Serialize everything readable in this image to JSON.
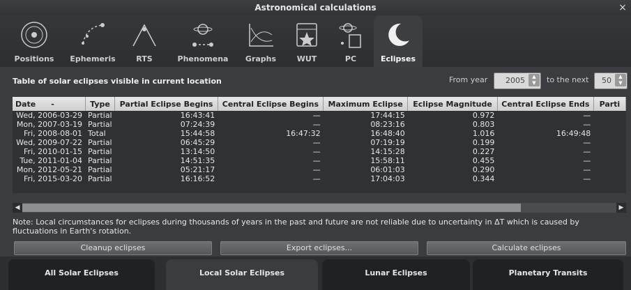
{
  "window": {
    "title": "Astronomical calculations",
    "close_glyph": "×"
  },
  "toolbar": {
    "tabs": [
      {
        "label": "Positions",
        "icon": "positions-icon"
      },
      {
        "label": "Ephemeris",
        "icon": "ephemeris-icon"
      },
      {
        "label": "RTS",
        "icon": "rts-icon"
      },
      {
        "label": "Phenomena",
        "icon": "phenomena-icon"
      },
      {
        "label": "Graphs",
        "icon": "graphs-icon"
      },
      {
        "label": "WUT",
        "icon": "wut-icon"
      },
      {
        "label": "PC",
        "icon": "pc-icon"
      },
      {
        "label": "Eclipses",
        "icon": "eclipses-icon"
      }
    ]
  },
  "main": {
    "heading": "Table of solar eclipses visible in current location",
    "from_year_label": "From year",
    "from_year_value": "2005",
    "to_next_label": "to the next",
    "to_next_value": "50"
  },
  "table": {
    "columns": [
      "Date",
      "Type",
      "Partial Eclipse Begins",
      "Central Eclipse Begins",
      "Maximum Eclipse",
      "Eclipse Magnitude",
      "Central Eclipse Ends",
      "Parti"
    ],
    "sort_marker": "-",
    "rows": [
      [
        "Wed, 2006-03-29",
        "Partial",
        "16:43:41",
        "—",
        "17:44:15",
        "0.972",
        "—",
        ""
      ],
      [
        "Mon, 2007-03-19",
        "Partial",
        "07:24:39",
        "—",
        "08:23:16",
        "0.803",
        "—",
        ""
      ],
      [
        "Fri, 2008-08-01",
        "Total",
        "15:44:58",
        "16:47:32",
        "16:48:40",
        "1.016",
        "16:49:48",
        ""
      ],
      [
        "Wed, 2009-07-22",
        "Partial",
        "06:45:29",
        "—",
        "07:19:19",
        "0.199",
        "—",
        ""
      ],
      [
        "Fri, 2010-01-15",
        "Partial",
        "13:14:50",
        "—",
        "14:15:28",
        "0.227",
        "—",
        ""
      ],
      [
        "Tue, 2011-01-04",
        "Partial",
        "14:51:35",
        "—",
        "15:58:11",
        "0.455",
        "—",
        ""
      ],
      [
        "Mon, 2012-05-21",
        "Partial",
        "05:21:17",
        "—",
        "06:01:03",
        "0.290",
        "—",
        ""
      ],
      [
        "Fri, 2015-03-20",
        "Partial",
        "16:16:52",
        "—",
        "17:04:03",
        "0.344",
        "—",
        ""
      ]
    ]
  },
  "note": "Note: Local circumstances for eclipses during thousands of years in the past and future are not reliable due to uncertainty in ΔT which is caused by fluctuations in Earth's rotation.",
  "buttons": {
    "cleanup": "Cleanup eclipses",
    "export": "Export eclipses...",
    "calculate": "Calculate eclipses"
  },
  "bottom_tabs": [
    "All Solar Eclipses",
    "Local Solar Eclipses",
    "Lunar Eclipses",
    "Planetary Transits"
  ]
}
